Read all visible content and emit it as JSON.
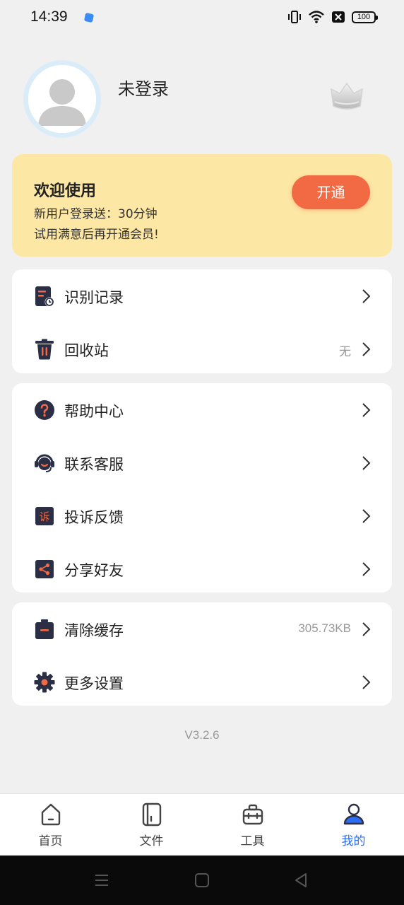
{
  "status_bar": {
    "time": "14:39",
    "battery": "100",
    "icons": [
      "vibrate-icon",
      "wifi-icon",
      "close-box-icon",
      "battery-icon"
    ]
  },
  "profile": {
    "username": "未登录",
    "avatar_icon": "avatar-placeholder-icon",
    "vip_icon": "crown-icon"
  },
  "promo": {
    "title": "欢迎使用",
    "line1": "新用户登录送：30分钟",
    "line2": "试用满意后再开通会员!",
    "button": "开通",
    "accent_color": "#f26a43",
    "background_color": "#fde7a5"
  },
  "menu_group1": [
    {
      "label": "识别记录",
      "value": "",
      "icon": "document-history-icon"
    },
    {
      "label": "回收站",
      "value": "无",
      "icon": "trash-icon"
    }
  ],
  "menu_group2": [
    {
      "label": "帮助中心",
      "value": "",
      "icon": "help-icon"
    },
    {
      "label": "联系客服",
      "value": "",
      "icon": "headset-icon"
    },
    {
      "label": "投诉反馈",
      "value": "",
      "icon": "complaint-icon",
      "glyph": "诉"
    },
    {
      "label": "分享好友",
      "value": "",
      "icon": "share-icon"
    }
  ],
  "menu_group3": [
    {
      "label": "清除缓存",
      "value": "305.73KB",
      "icon": "clear-cache-icon"
    },
    {
      "label": "更多设置",
      "value": "",
      "icon": "settings-gear-icon"
    }
  ],
  "version": "V3.2.6",
  "bottom_nav": [
    {
      "label": "首页",
      "icon": "home-icon",
      "active": false
    },
    {
      "label": "文件",
      "icon": "file-icon",
      "active": false
    },
    {
      "label": "工具",
      "icon": "toolbox-icon",
      "active": false
    },
    {
      "label": "我的",
      "icon": "profile-icon",
      "active": true
    }
  ],
  "active_color": "#2c6df2",
  "icon_color": "#2b2f45",
  "icon_accent": "#f26a43"
}
